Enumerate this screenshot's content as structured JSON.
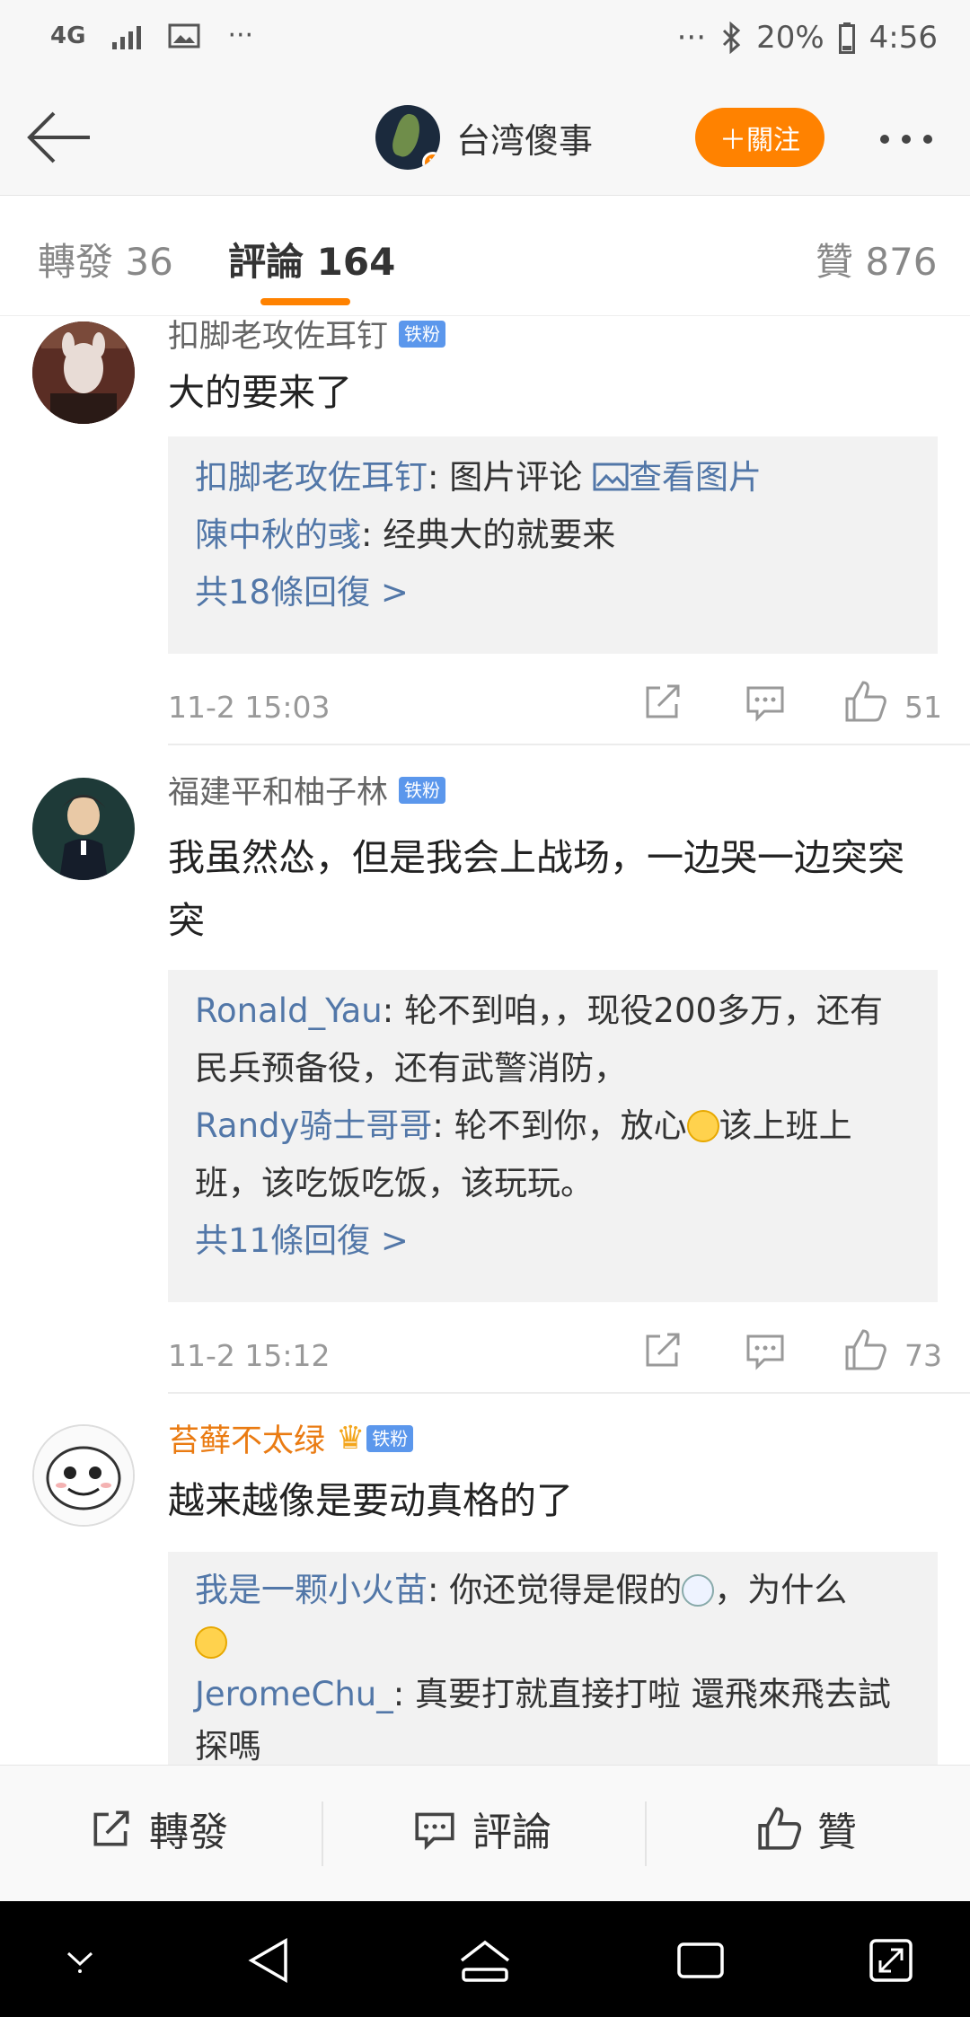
{
  "status_bar": {
    "network": "4G",
    "dots": "···",
    "battery": "20%",
    "time": "4:56"
  },
  "header": {
    "title": "台湾傻事",
    "follow_label": "＋關注"
  },
  "tabs": {
    "reposts": "轉發 36",
    "comments": "評論 164",
    "likes": "贊 876"
  },
  "comments": [
    {
      "user": "扣脚老攻佐耳钉",
      "badge": "铁粉",
      "text": "大的要来了",
      "replies": [
        {
          "user": "扣脚老攻佐耳钉",
          "sep": ": ",
          "text": "图片评论 ",
          "link": "查看图片"
        },
        {
          "user": "陳中秋的彧",
          "sep": ": ",
          "text": "经典大的就要来"
        }
      ],
      "more_replies": "共18條回復 >",
      "date": "11-2 15:03",
      "likes": "51"
    },
    {
      "user": "福建平和柚子林",
      "badge": "铁粉",
      "text": "我虽然怂，但是我会上战场，一边哭一边突突突",
      "replies": [
        {
          "user": "Ronald_Yau",
          "sep": ": ",
          "text": "轮不到咱，，现役200多万，还有民兵预备役，还有武警消防，"
        },
        {
          "user": "Randy骑士哥哥",
          "sep": ": ",
          "text_a": "轮不到你，放心",
          "text_b": "该上班上班，该吃饭吃饭，该玩玩。"
        }
      ],
      "more_replies": "共11條回復 >",
      "date": "11-2 15:12",
      "likes": "73"
    },
    {
      "user": "苔藓不太绿",
      "badge": "铁粉",
      "text": "越来越像是要动真格的了",
      "replies": [
        {
          "user": "我是一颗小火苗",
          "sep": ": ",
          "text_a": "你还觉得是假的",
          "text_b": "，为什么"
        },
        {
          "user": "JeromeChu_",
          "sep": ": ",
          "text": "真要打就直接打啦 還飛來飛去試探嗎"
        }
      ]
    }
  ],
  "action_bar": {
    "repost": "轉發",
    "comment": "評論",
    "like": "贊"
  },
  "colors": {
    "accent": "#ff8200",
    "link": "#5277a8",
    "fan_badge": "#5b97ec"
  }
}
